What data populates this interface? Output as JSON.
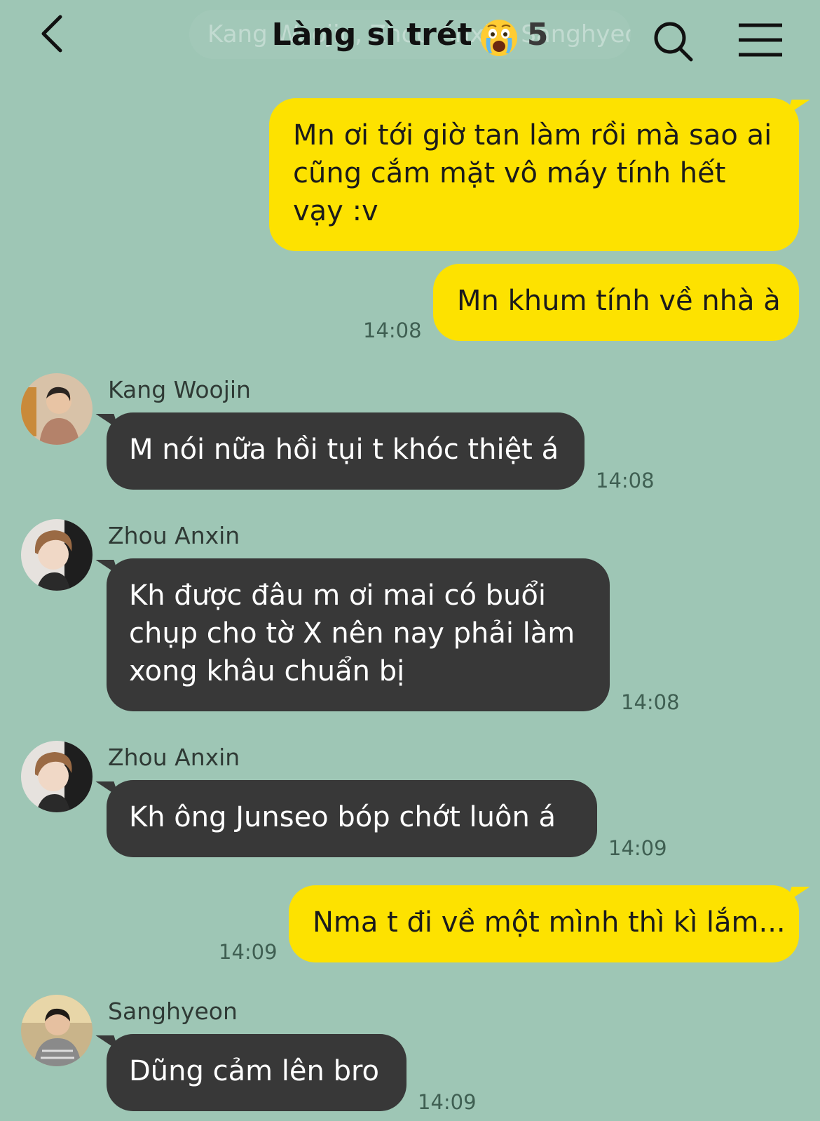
{
  "header": {
    "title": "Làng sì trét",
    "member_count": "5",
    "ghost_banner": "Kang Woojin, Zhou Anxin, Sanghyeon, Junseo, Kyungwon"
  },
  "messages": [
    {
      "from": "me",
      "text": "Mn ơi tới giờ tan làm rồi mà sao ai cũng cắm mặt vô máy tính hết vạy :v",
      "time": ""
    },
    {
      "from": "me",
      "text": "Mn khum tính về nhà à",
      "time": "14:08"
    },
    {
      "from": "other",
      "sender": "Kang Woojin",
      "text": "M nói nữa hồi tụi t khóc thiệt á",
      "time": "14:08"
    },
    {
      "from": "other",
      "sender": "Zhou Anxin",
      "text": "Kh được đâu m ơi mai có buổi chụp cho tờ X nên nay phải làm xong khâu chuẩn bị",
      "time": "14:08"
    },
    {
      "from": "other",
      "sender": "Zhou Anxin",
      "text": "Kh ông Junseo bóp chớt luôn á",
      "time": "14:09"
    },
    {
      "from": "me",
      "text": "Nma t đi về một mình thì kì lắm...",
      "time": "14:09"
    },
    {
      "from": "other",
      "sender": "Sanghyeon",
      "text": "Dũng cảm lên bro",
      "time": "14:09"
    }
  ],
  "colors": {
    "background": "#9ec6b5",
    "my_bubble": "#fde200",
    "other_bubble": "#383838",
    "time_text": "#3f5f52"
  },
  "icons": {
    "back": "chevron-left-icon",
    "emoji": "crying-face-emoji",
    "search": "search-icon",
    "menu": "hamburger-menu-icon"
  }
}
